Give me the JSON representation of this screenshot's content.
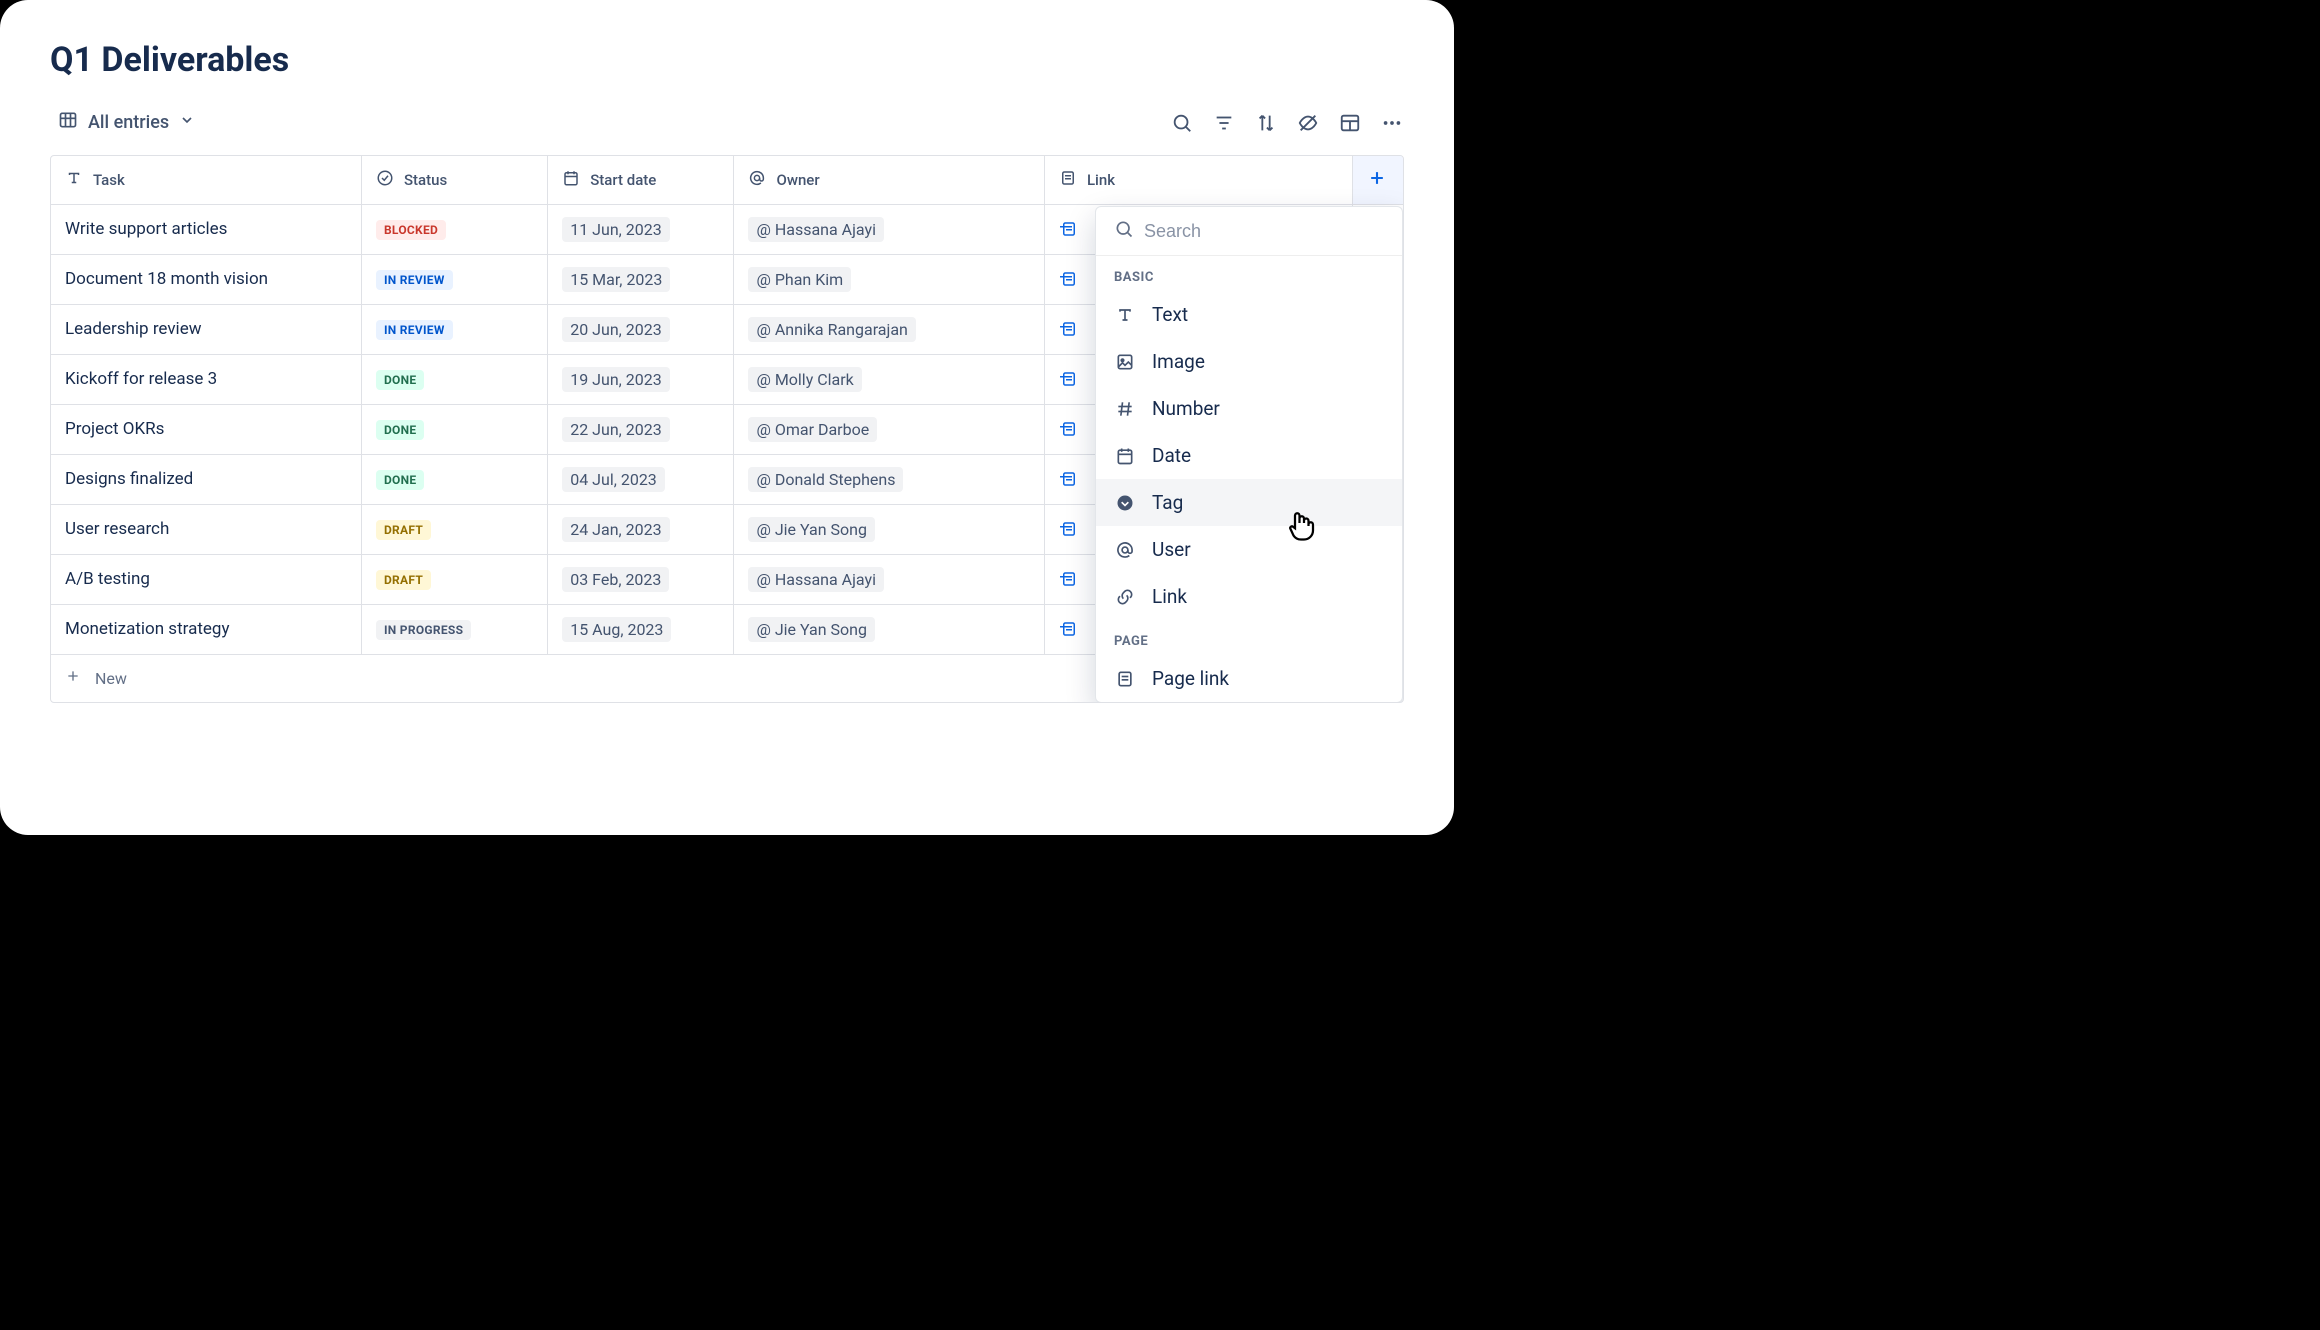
{
  "title": "Q1 Deliverables",
  "view": {
    "label": "All entries"
  },
  "columns": {
    "task": {
      "label": "Task"
    },
    "status": {
      "label": "Status"
    },
    "date": {
      "label": "Start date"
    },
    "owner": {
      "label": "Owner"
    },
    "link": {
      "label": "Link"
    }
  },
  "rows": [
    {
      "task": "Write support articles",
      "status": "BLOCKED",
      "date": "11 Jun, 2023",
      "owner": "Hassana Ajayi"
    },
    {
      "task": "Document 18 month vision",
      "status": "IN REVIEW",
      "date": "15 Mar, 2023",
      "owner": "Phan Kim"
    },
    {
      "task": "Leadership review",
      "status": "IN REVIEW",
      "date": "20 Jun, 2023",
      "owner": "Annika Rangarajan"
    },
    {
      "task": "Kickoff for release 3",
      "status": "DONE",
      "date": "19 Jun, 2023",
      "owner": "Molly Clark"
    },
    {
      "task": "Project OKRs",
      "status": "DONE",
      "date": "22 Jun, 2023",
      "owner": "Omar Darboe"
    },
    {
      "task": "Designs finalized",
      "status": "DONE",
      "date": "04 Jul, 2023",
      "owner": "Donald Stephens"
    },
    {
      "task": "User research",
      "status": "DRAFT",
      "date": "24 Jan, 2023",
      "owner": "Jie Yan Song"
    },
    {
      "task": "A/B testing",
      "status": "DRAFT",
      "date": "03 Feb, 2023",
      "owner": "Hassana Ajayi"
    },
    {
      "task": "Monetization strategy",
      "status": "IN PROGRESS",
      "date": "15 Aug, 2023",
      "owner": "Jie Yan Song"
    }
  ],
  "newRowLabel": "New",
  "dropdown": {
    "searchPlaceholder": "Search",
    "sectionBasic": "BASIC",
    "sectionPage": "PAGE",
    "items": {
      "text": "Text",
      "image": "Image",
      "number": "Number",
      "date": "Date",
      "tag": "Tag",
      "user": "User",
      "link": "Link",
      "pagelink": "Page link"
    }
  }
}
